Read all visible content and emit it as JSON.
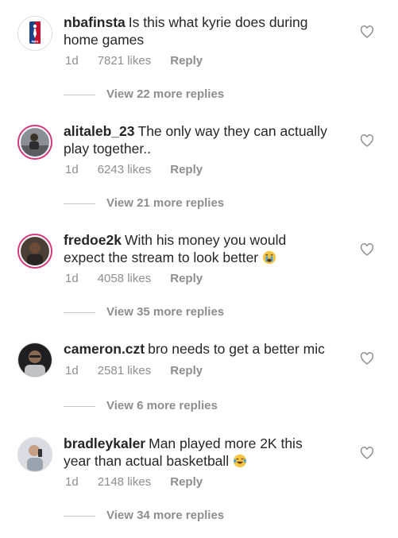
{
  "comments": [
    {
      "username": "nbafinsta",
      "text": "Is this what kyrie does during home games",
      "time": "1d",
      "likes": "7821 likes",
      "reply": "Reply",
      "more_replies": "View 22 more replies",
      "avatar": "nba-logo-icon"
    },
    {
      "username": "alitaleb_23",
      "text": "The only way they can actually play together..",
      "time": "1d",
      "likes": "6243 likes",
      "reply": "Reply",
      "more_replies": "View 21 more replies",
      "avatar": "profile-photo"
    },
    {
      "username": "fredoe2k",
      "text": "With his money you would expect the stream to look better",
      "time": "1d",
      "likes": "4058 likes",
      "reply": "Reply",
      "more_replies": "View 35 more replies",
      "avatar": "profile-photo",
      "emoji": "crying-face-emoji"
    },
    {
      "username": "cameron.czt",
      "text": "bro needs to get a better mic",
      "time": "1d",
      "likes": "2581 likes",
      "reply": "Reply",
      "more_replies": "View 6 more replies",
      "avatar": "profile-photo"
    },
    {
      "username": "bradleykaler",
      "text": "Man played more 2K this year than actual basketball",
      "time": "1d",
      "likes": "2148 likes",
      "reply": "Reply",
      "more_replies": "View 34 more replies",
      "avatar": "profile-photo",
      "emoji": "tears-of-joy-emoji"
    }
  ],
  "colors": {
    "text": "#262626",
    "muted": "#8e8e8e",
    "story_ring": "#d4387e"
  }
}
